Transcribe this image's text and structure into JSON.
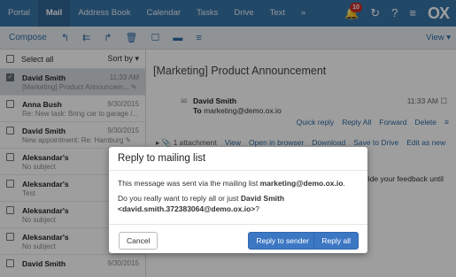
{
  "topbar": {
    "tabs": [
      "Portal",
      "Mail",
      "Address Book",
      "Calendar",
      "Tasks",
      "Drive",
      "Text",
      "»"
    ],
    "active_tab": "Mail",
    "notification_count": "10",
    "logo": "OX",
    "icons": [
      "bell-icon",
      "refresh-icon",
      "help-icon",
      "menu-icon"
    ]
  },
  "toolbar": {
    "compose": "Compose",
    "view": "View ▾",
    "icons": [
      "reply-icon",
      "reply-all-icon",
      "forward-icon",
      "trash-icon",
      "bookmark-icon",
      "archive-icon",
      "more-icon"
    ]
  },
  "list": {
    "select_all": "Select all",
    "sort": "Sort by ▾",
    "items": [
      {
        "from": "David Smith",
        "time": "11:33 AM",
        "subject": "[Marketing] Product Announcem... ✎",
        "selected": true
      },
      {
        "from": "Anna Bush",
        "time": "9/30/2015",
        "subject": "Re: New task: Bring car to garage /..."
      },
      {
        "from": "David Smith",
        "time": "9/30/2015",
        "subject": "New appointment: Re: Hamburg ✎"
      },
      {
        "from": "Aleksandar's",
        "time": "",
        "subject": "No subject"
      },
      {
        "from": "Aleksandar's",
        "time": "",
        "subject": "Test"
      },
      {
        "from": "Aleksandar's",
        "time": "",
        "subject": "No subject"
      },
      {
        "from": "Aleksandar's",
        "time": "",
        "subject": "No subject"
      },
      {
        "from": "David Smith",
        "time": "9/30/2015",
        "subject": ""
      }
    ]
  },
  "message": {
    "subject": "[Marketing] Product Announcement",
    "from": "David Smith",
    "to_label": "To",
    "to": "marketing@demo.ox.io",
    "time": "11:33 AM",
    "actions": [
      "Quick reply",
      "Reply All",
      "Forward",
      "Delete"
    ],
    "attachment": "1 attachment",
    "attachment_actions": [
      "View",
      "Open in browser",
      "Download",
      "Save to Drive",
      "Edit as new"
    ],
    "body_snippet": "rovide your feedback until"
  },
  "dialog": {
    "title": "Reply to mailing list",
    "line1_prefix": "This message was sent via the mailing list ",
    "line1_list": "marketing@demo.ox.io",
    "line1_suffix": ".",
    "line2_prefix": "Do you really want to reply all or just ",
    "line2_name": "David Smith",
    "line2_email": "<david.smith.372383064@demo.ox.io>",
    "line2_suffix": "?",
    "cancel": "Cancel",
    "reply_sender": "Reply to sender",
    "reply_all": "Reply all"
  }
}
